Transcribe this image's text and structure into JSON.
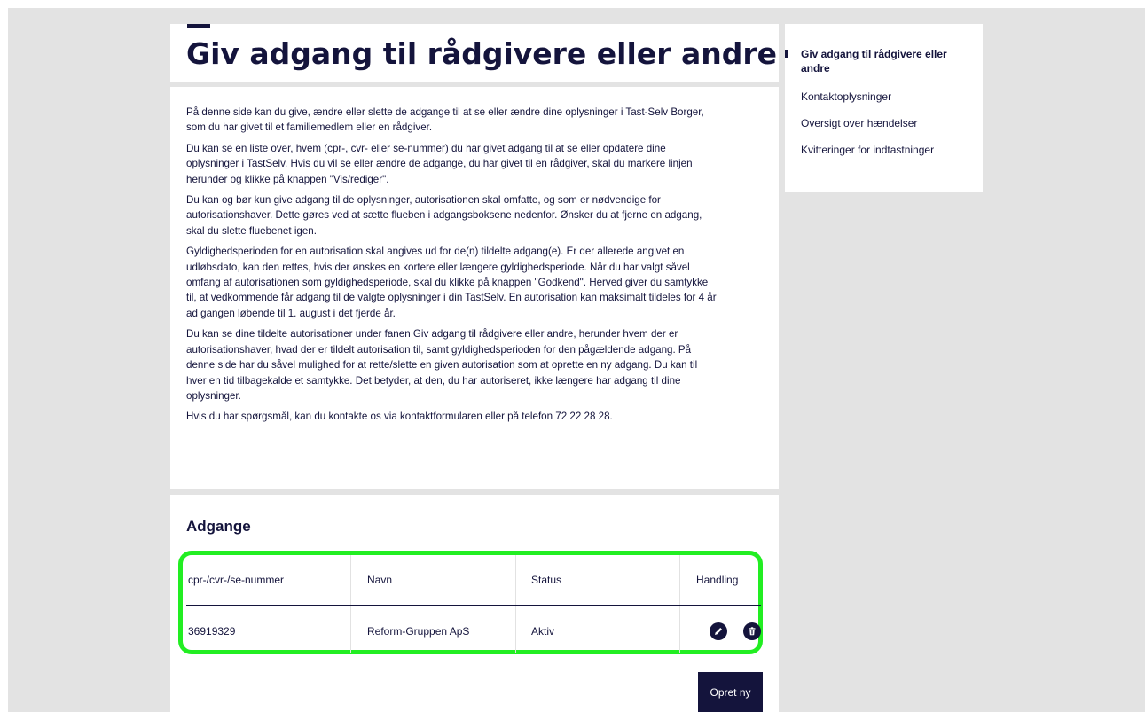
{
  "page": {
    "title": "Giv adgang til rådgivere eller andre"
  },
  "intro": {
    "paragraphs": [
      "På denne side kan du give, ændre eller slette de adgange til at se eller ændre dine oplysninger i Tast-Selv Borger, som du har givet til et familiemedlem eller en rådgiver.",
      "Du kan se en liste over, hvem (cpr-, cvr- eller se-nummer) du har givet adgang til at se eller opdatere dine oplysninger i TastSelv. Hvis du vil se eller ændre de adgange, du har givet til en rådgiver, skal du markere linjen herunder og klikke på knappen \"Vis/rediger\".",
      "Du kan og bør kun give adgang til de oplysninger, autorisationen skal omfatte, og som er nødvendige for autorisationshaver. Dette gøres ved at sætte flueben i adgangsboksene nedenfor. Ønsker du at fjerne en adgang, skal du slette fluebenet igen.",
      "Gyldighedsperioden for en autorisation skal angives ud for de(n) tildelte adgang(e). Er der allerede angivet en udløbsdato, kan den rettes, hvis der ønskes en kortere eller længere gyldighedsperiode. Når du har valgt såvel omfang af autorisationen som gyldighedsperiode, skal du klikke på knappen \"Godkend\". Herved giver du samtykke til, at vedkommende får adgang til de valgte oplysninger i din TastSelv. En autorisation kan maksimalt tildeles for 4 år ad gangen løbende til 1. august i det fjerde år.",
      "Du kan se dine tildelte autorisationer under fanen Giv adgang til rådgivere eller andre, herunder hvem der er autorisationshaver, hvad der er tildelt autorisation til, samt gyldighedsperioden for den pågæl­dende adgang. På denne side har du såvel mulighed for at rette/slette en given autorisation som at oprette en ny adgang. Du kan til hver en tid tilbagekalde et samtykke. Det betyder, at den, du har au­toriseret, ikke længere har adgang til dine oplysninger.",
      "Hvis du har spørgsmål, kan du kontakte os via kontaktformularen eller på telefon 72 22 28 28."
    ]
  },
  "access": {
    "title": "Adgange",
    "columns": [
      "cpr-/cvr-/se-nummer",
      "Navn",
      "Status",
      "Handling"
    ],
    "rows": [
      {
        "number": "36919329",
        "name": "Reform-Gruppen ApS",
        "status": "Aktiv",
        "edit_icon": "pencil-icon",
        "delete_icon": "trash-icon"
      }
    ],
    "create_button": "Opret ny"
  },
  "toc": {
    "items": [
      "Giv adgang til rådgivere eller andre",
      "Kontaktoplysninger",
      "Oversigt over hændelser",
      "Kvitteringer for indtastninger"
    ],
    "active_index": 0
  },
  "colors": {
    "navy": "#14143c",
    "background": "#e3e3e3",
    "highlight": "#22ee22"
  }
}
